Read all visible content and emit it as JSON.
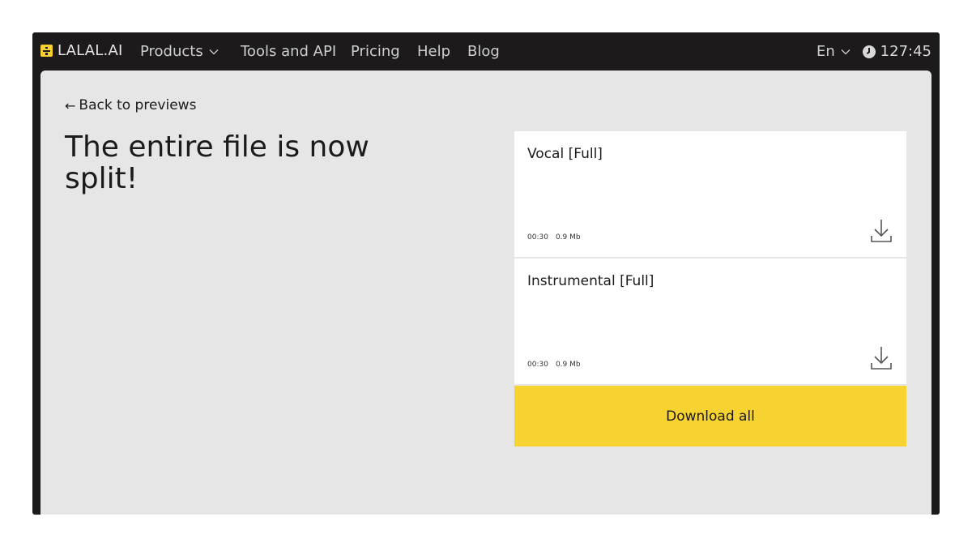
{
  "nav": {
    "logo_text": "LALAL.AI",
    "items": [
      {
        "label": "Products",
        "has_dropdown": true
      },
      {
        "label": "Tools and API"
      },
      {
        "label": "Pricing"
      },
      {
        "label": "Help"
      },
      {
        "label": "Blog"
      }
    ],
    "language": "En",
    "balance": "127:45"
  },
  "main": {
    "back_label": "Back to previews",
    "headline": "The entire file is now split!",
    "tracks": [
      {
        "title": "Vocal [Full]",
        "duration": "00:30",
        "size": "0.9 Mb"
      },
      {
        "title": "Instrumental [Full]",
        "duration": "00:30",
        "size": "0.9 Mb"
      }
    ],
    "download_all_label": "Download all"
  },
  "colors": {
    "accent": "#f7d331",
    "nav_bg": "#1c1a1b",
    "content_bg": "#e6e6e6"
  },
  "icons": [
    "logo-divide-icon",
    "chevron-down-icon",
    "clock-icon",
    "arrow-left-icon",
    "download-icon"
  ]
}
